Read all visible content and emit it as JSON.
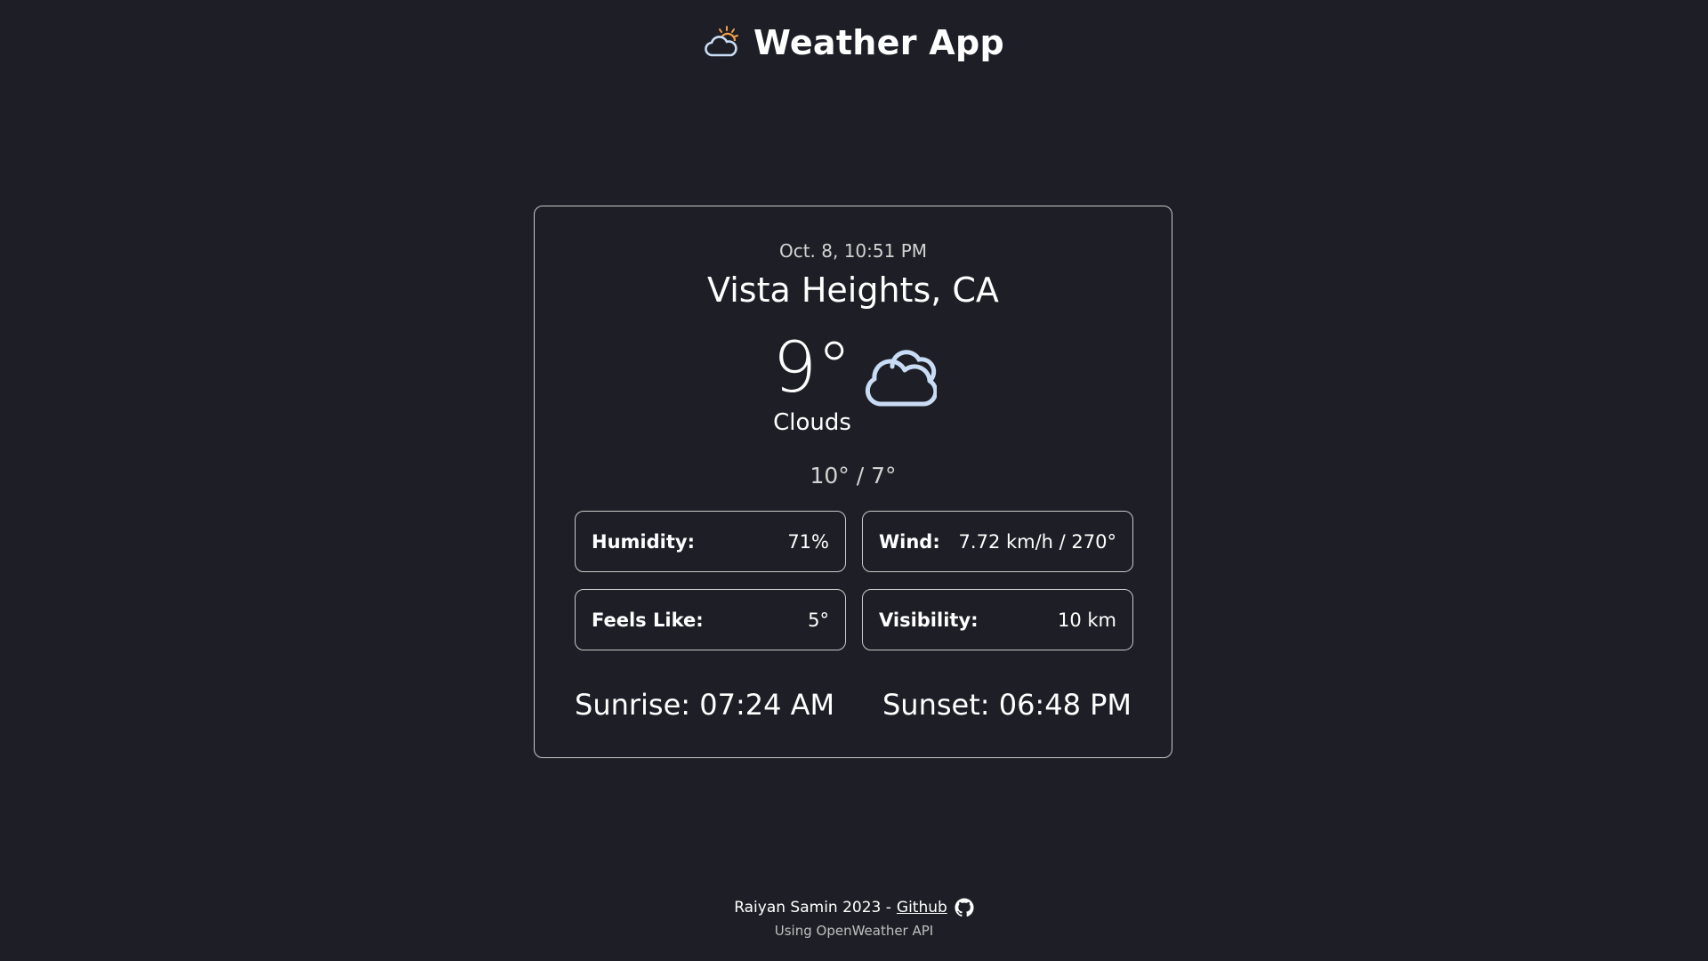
{
  "header": {
    "title": "Weather App",
    "icon": "sun-behind-cloud-icon"
  },
  "weather": {
    "date_time": "Oct. 8, 10:51 PM",
    "city": "Vista Heights, CA",
    "temperature": "9°",
    "condition": "Clouds",
    "condition_icon": "cloud-icon",
    "high_low": "10° / 7°"
  },
  "stats": {
    "humidity_label": "Humidity:",
    "humidity_value": "71%",
    "wind_label": "Wind:",
    "wind_value": "7.72 km/h / 270°",
    "feels_like_label": "Feels Like:",
    "feels_like_value": "5°",
    "visibility_label": "Visibility:",
    "visibility_value": "10 km"
  },
  "sun": {
    "sunrise": "Sunrise: 07:24 AM",
    "sunset": "Sunset: 06:48 PM"
  },
  "footer": {
    "author": "Raiyan Samin 2023 -",
    "link_label": "Github",
    "link_icon": "github-icon",
    "api_note": "Using OpenWeather API"
  },
  "colors": {
    "background": "#1e1f26",
    "border": "#c8c8c8",
    "cloud_icon": "#c9dcf5",
    "sun_accent": "#f0a04b"
  }
}
